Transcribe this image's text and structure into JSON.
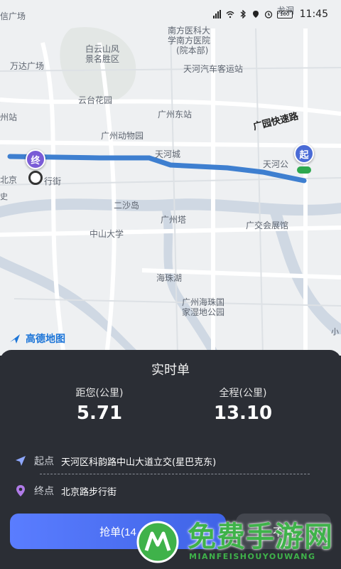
{
  "status_bar": {
    "time": "11:45",
    "battery": "100"
  },
  "map": {
    "labels": {
      "l1": "信广场",
      "l2": "白云山风",
      "l3": "景名胜区",
      "l4": "南方医科大",
      "l5": "学南方医院",
      "l6": "(院本部)",
      "l7": "万达广场",
      "l8": "天河汽车客运站",
      "l9": "云台花园",
      "l10": "广州东站",
      "l11": "州站",
      "l12": "广州动物园",
      "l13": "广园快速路",
      "l14": "天河城",
      "l15": "天河公",
      "l16": "北京",
      "l17": "行街",
      "l18": "二沙岛",
      "l19": "广州塔",
      "l20": "广交会展馆",
      "l21": "中山大学",
      "l22": "海珠湖",
      "l23": "广州海珠国",
      "l24": "家湿地公园",
      "l25": "龙洞",
      "l26": "史",
      "l27": "小"
    },
    "marker_end": "终",
    "marker_start": "起",
    "logo": "高德地图",
    "route_color": "#3e7fd0"
  },
  "order": {
    "title": "实时单",
    "distance_label": "距您(公里)",
    "distance_value": "5.71",
    "total_label": "全程(公里)",
    "total_value": "13.10",
    "start_keyword": "起点",
    "start_address": "天河区科韵路中山大道立交(星巴克东)",
    "end_keyword": "终点",
    "end_address": "北京路步行街",
    "grab_button": "抢单(14",
    "reject_button": "不抢"
  },
  "watermark": {
    "text": "免费手游网",
    "sub": "MIANFEISHOUYOUWANG"
  }
}
